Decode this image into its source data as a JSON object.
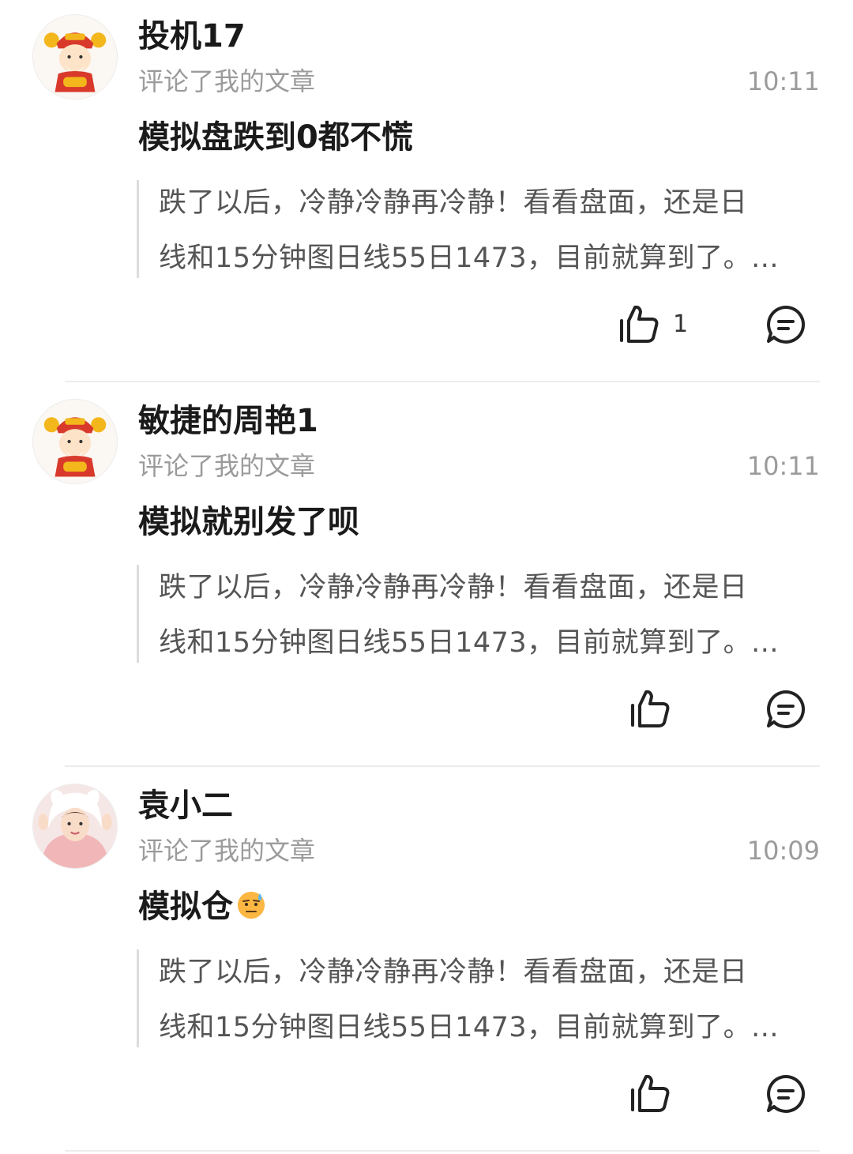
{
  "notifications": [
    {
      "username": "投机17",
      "action": "评论了我的文章",
      "time": "10:11",
      "comment": "模拟盘跌到0都不慌",
      "comment_emoji": "",
      "quote_line1": "跌了以后，冷静冷静再冷静！看看盘面，还是日",
      "quote_line2": "线和15分钟图日线55日1473，目前就算到了。...",
      "like_count": "1",
      "avatar_icon": "caishen-avatar-icon"
    },
    {
      "username": "敏捷的周艳1",
      "action": "评论了我的文章",
      "time": "10:11",
      "comment": "模拟就别发了呗",
      "comment_emoji": "",
      "quote_line1": "跌了以后，冷静冷静再冷静！看看盘面，还是日",
      "quote_line2": "线和15分钟图日线55日1473，目前就算到了。...",
      "like_count": "",
      "avatar_icon": "caishen-avatar-icon"
    },
    {
      "username": "袁小二",
      "action": "评论了我的文章",
      "time": "10:09",
      "comment": "模拟仓",
      "comment_emoji": "sweat-emoji-icon",
      "quote_line1": "跌了以后，冷静冷静再冷静！看看盘面，还是日",
      "quote_line2": "线和15分钟图日线55日1473，目前就算到了。...",
      "like_count": "",
      "avatar_icon": "girl-photo-avatar-icon"
    }
  ],
  "icons": {
    "like": "thumbs-up-icon",
    "reply": "reply-bubble-icon"
  },
  "colors": {
    "text_primary": "#1a1a1a",
    "text_secondary": "#9b9b9b",
    "quote_bar": "#dddddd",
    "divider": "#ececec",
    "avatar_red": "#d8392b",
    "avatar_gold": "#f3b71c"
  }
}
